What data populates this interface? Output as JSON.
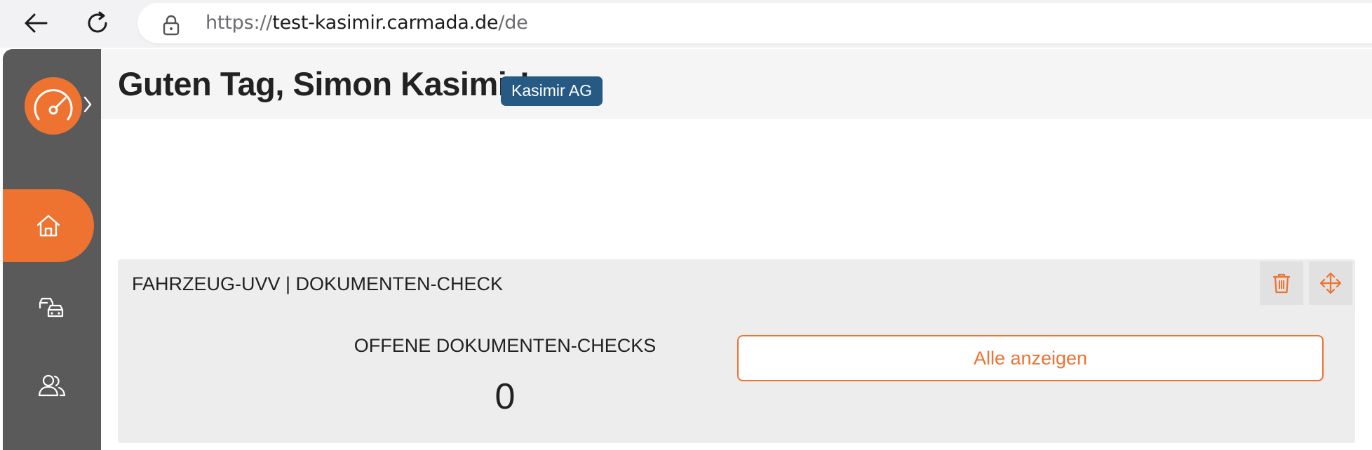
{
  "browser": {
    "url_scheme": "https://",
    "url_host": "test-kasimir.carmada.de",
    "url_path": "/de",
    "icons": [
      "back-arrow-icon",
      "reload-icon",
      "lock-icon"
    ]
  },
  "sidebar": {
    "logo_icon": "speedometer-icon",
    "expand_icon": "chevron-right-icon",
    "items": [
      {
        "id": "home",
        "icon": "home-icon",
        "active": true
      },
      {
        "id": "vehicles",
        "icon": "cars-icon",
        "active": false
      },
      {
        "id": "users",
        "icon": "users-icon",
        "active": false
      }
    ]
  },
  "header": {
    "greeting": "Guten Tag, Simon Kasimir!",
    "company_badge": "Kasimir AG"
  },
  "widget": {
    "title": "FAHRZEUG-UVV | DOKUMENTEN-CHECK",
    "stat_label": "OFFENE DOKUMENTEN-CHECKS",
    "stat_value": "0",
    "button_label": "Alle anzeigen",
    "tools": [
      "trash-icon",
      "move-icon"
    ]
  },
  "colors": {
    "accent": "#ee7230",
    "sidebar_bg": "#5a5a5a",
    "badge_bg": "#265a83",
    "widget_bg": "#ededed"
  }
}
